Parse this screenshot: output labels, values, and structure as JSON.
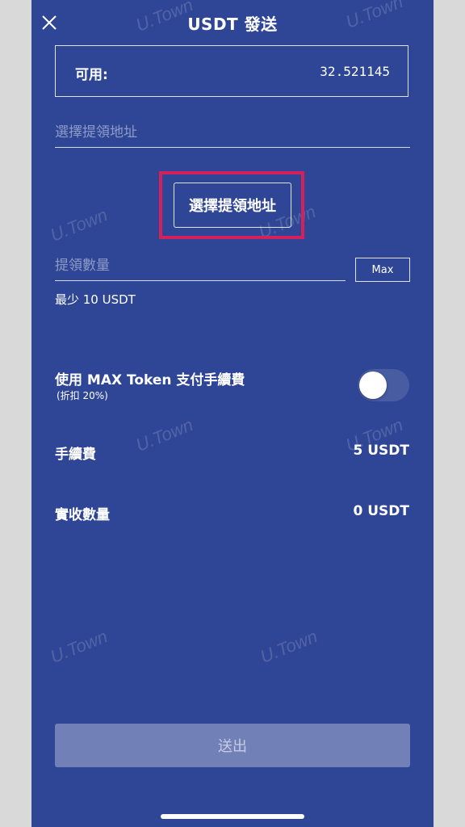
{
  "header": {
    "title": "USDT 發送",
    "close_icon": "close-icon"
  },
  "available": {
    "label": "可用:",
    "value": "32.521145"
  },
  "address_field": {
    "placeholder": "選擇提領地址"
  },
  "select_address_button": {
    "label": "選擇提領地址"
  },
  "amount_field": {
    "placeholder": "提領數量"
  },
  "max_button": {
    "label": "Max"
  },
  "min_amount": {
    "text": "最少 10 USDT"
  },
  "max_token": {
    "label": "使用 MAX Token 支付手續費",
    "sub_label": "(折扣 20%)",
    "enabled": false
  },
  "fee": {
    "label": "手續費",
    "value": "5 USDT"
  },
  "received": {
    "label": "實收數量",
    "value": "0 USDT"
  },
  "submit_button": {
    "label": "送出"
  },
  "watermark": {
    "text": "U.Town"
  },
  "colors": {
    "background": "#2f4696",
    "highlight": "#d6205c"
  }
}
